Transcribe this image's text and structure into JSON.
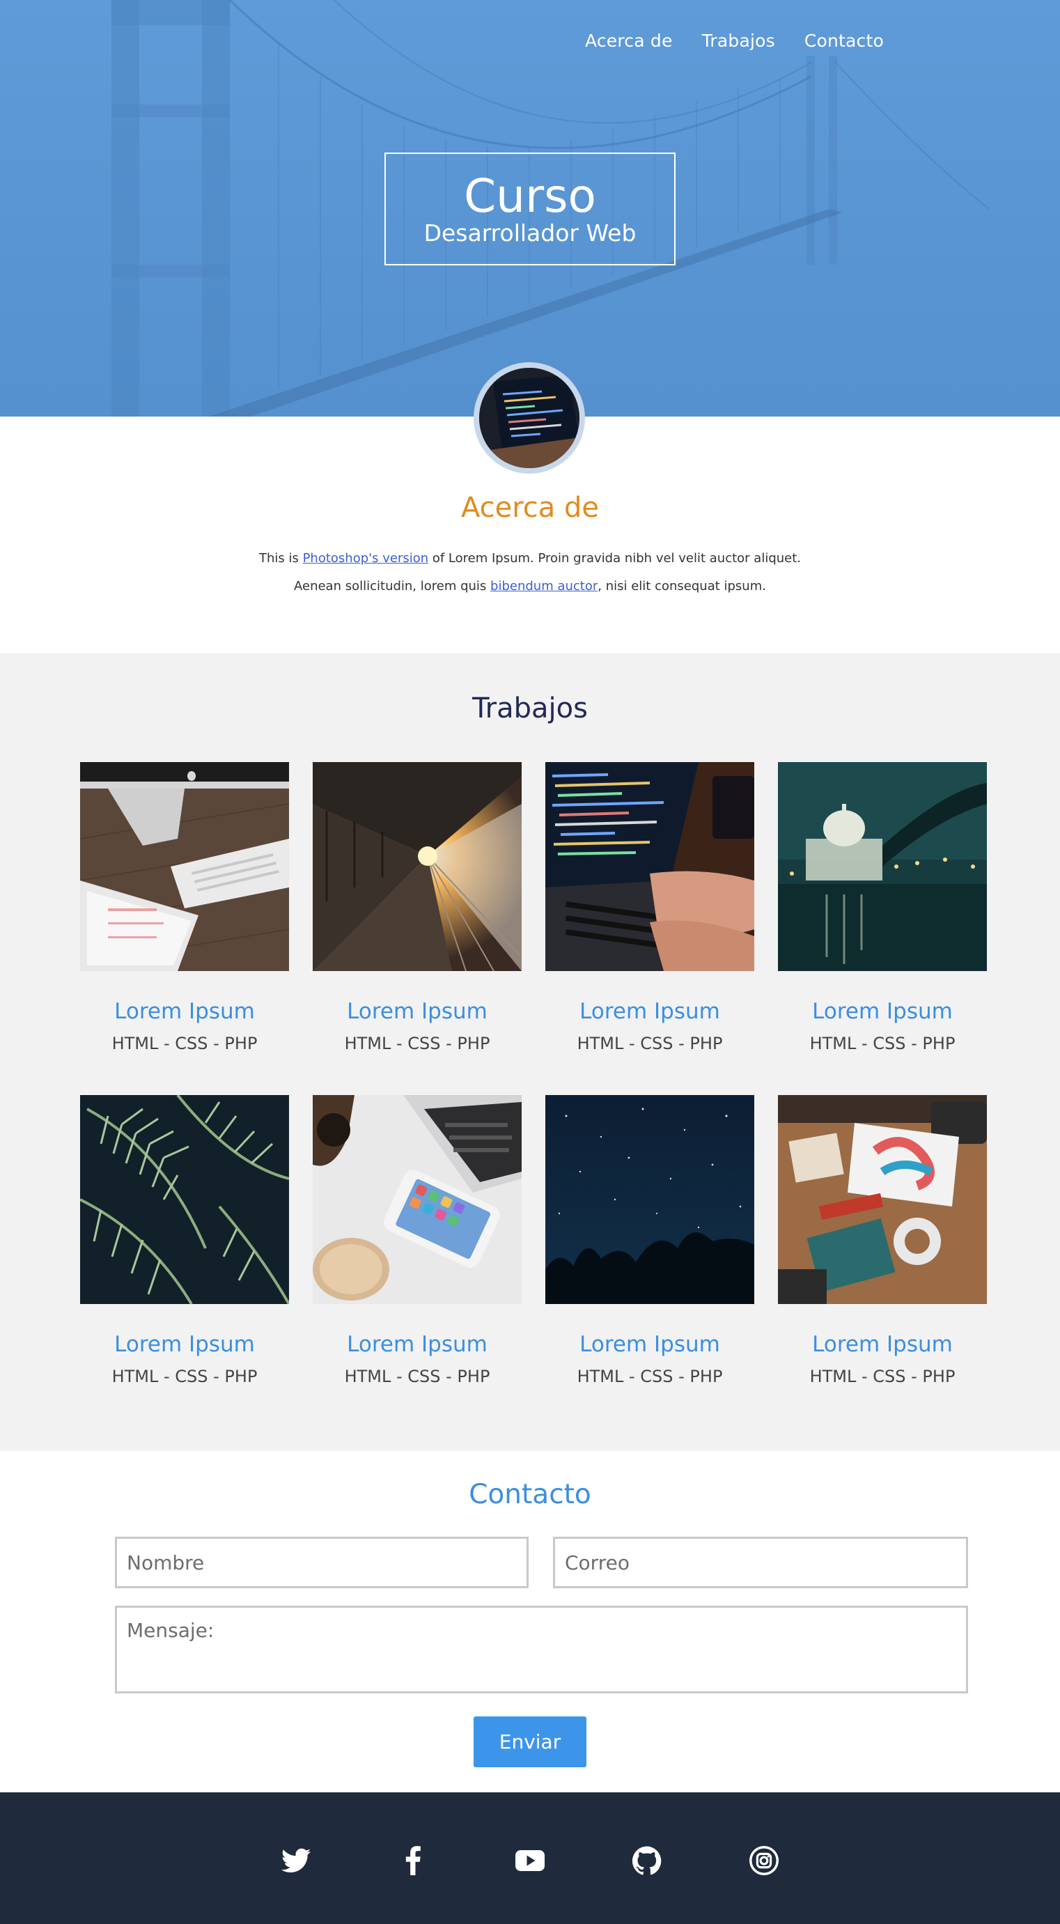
{
  "nav": {
    "about": "Acerca de",
    "works": "Trabajos",
    "contact": "Contacto"
  },
  "hero": {
    "title": "Curso",
    "subtitle": "Desarrollador Web"
  },
  "about": {
    "heading": "Acerca de",
    "text_1": "This is ",
    "link_1": "Photoshop's version",
    "text_2": " of Lorem Ipsum. Proin gravida nibh vel velit auctor aliquet. Aenean sollicitudin, lorem quis ",
    "link_2": "bibendum auctor",
    "text_3": ", nisi elit consequat ipsum."
  },
  "works": {
    "heading": "Trabajos",
    "items": [
      {
        "title": "Lorem Ipsum",
        "tags": "HTML - CSS - PHP",
        "image": "desk-with-imac-keyboard-tablet"
      },
      {
        "title": "Lorem Ipsum",
        "tags": "HTML - CSS - PHP",
        "image": "train-platform-at-sunset"
      },
      {
        "title": "Lorem Ipsum",
        "tags": "HTML - CSS - PHP",
        "image": "hands-typing-code-on-laptop"
      },
      {
        "title": "Lorem Ipsum",
        "tags": "HTML - CSS - PHP",
        "image": "city-cathedral-at-night-by-river"
      },
      {
        "title": "Lorem Ipsum",
        "tags": "HTML - CSS - PHP",
        "image": "fern-leaves"
      },
      {
        "title": "Lorem Ipsum",
        "tags": "HTML - CSS - PHP",
        "image": "laptop-phone-coffee-flatlay"
      },
      {
        "title": "Lorem Ipsum",
        "tags": "HTML - CSS - PHP",
        "image": "starry-night-sky-over-trees"
      },
      {
        "title": "Lorem Ipsum",
        "tags": "HTML - CSS - PHP",
        "image": "design-workspace-flatlay"
      }
    ]
  },
  "contact": {
    "heading": "Contacto",
    "name_placeholder": "Nombre",
    "email_placeholder": "Correo",
    "message_placeholder": "Mensaje:",
    "submit_label": "Enviar"
  },
  "footer": {
    "socials": [
      "twitter-icon",
      "facebook-icon",
      "youtube-icon",
      "github-icon",
      "instagram-icon"
    ]
  },
  "colors": {
    "hero_blue": "#5f9bd8",
    "about_heading": "#e38a1e",
    "works_heading": "#1f2a56",
    "accent_blue": "#3b8ee0",
    "button_blue": "#3d95ea",
    "works_bg": "#f2f2f2",
    "footer_bg": "#1f2a3c"
  }
}
